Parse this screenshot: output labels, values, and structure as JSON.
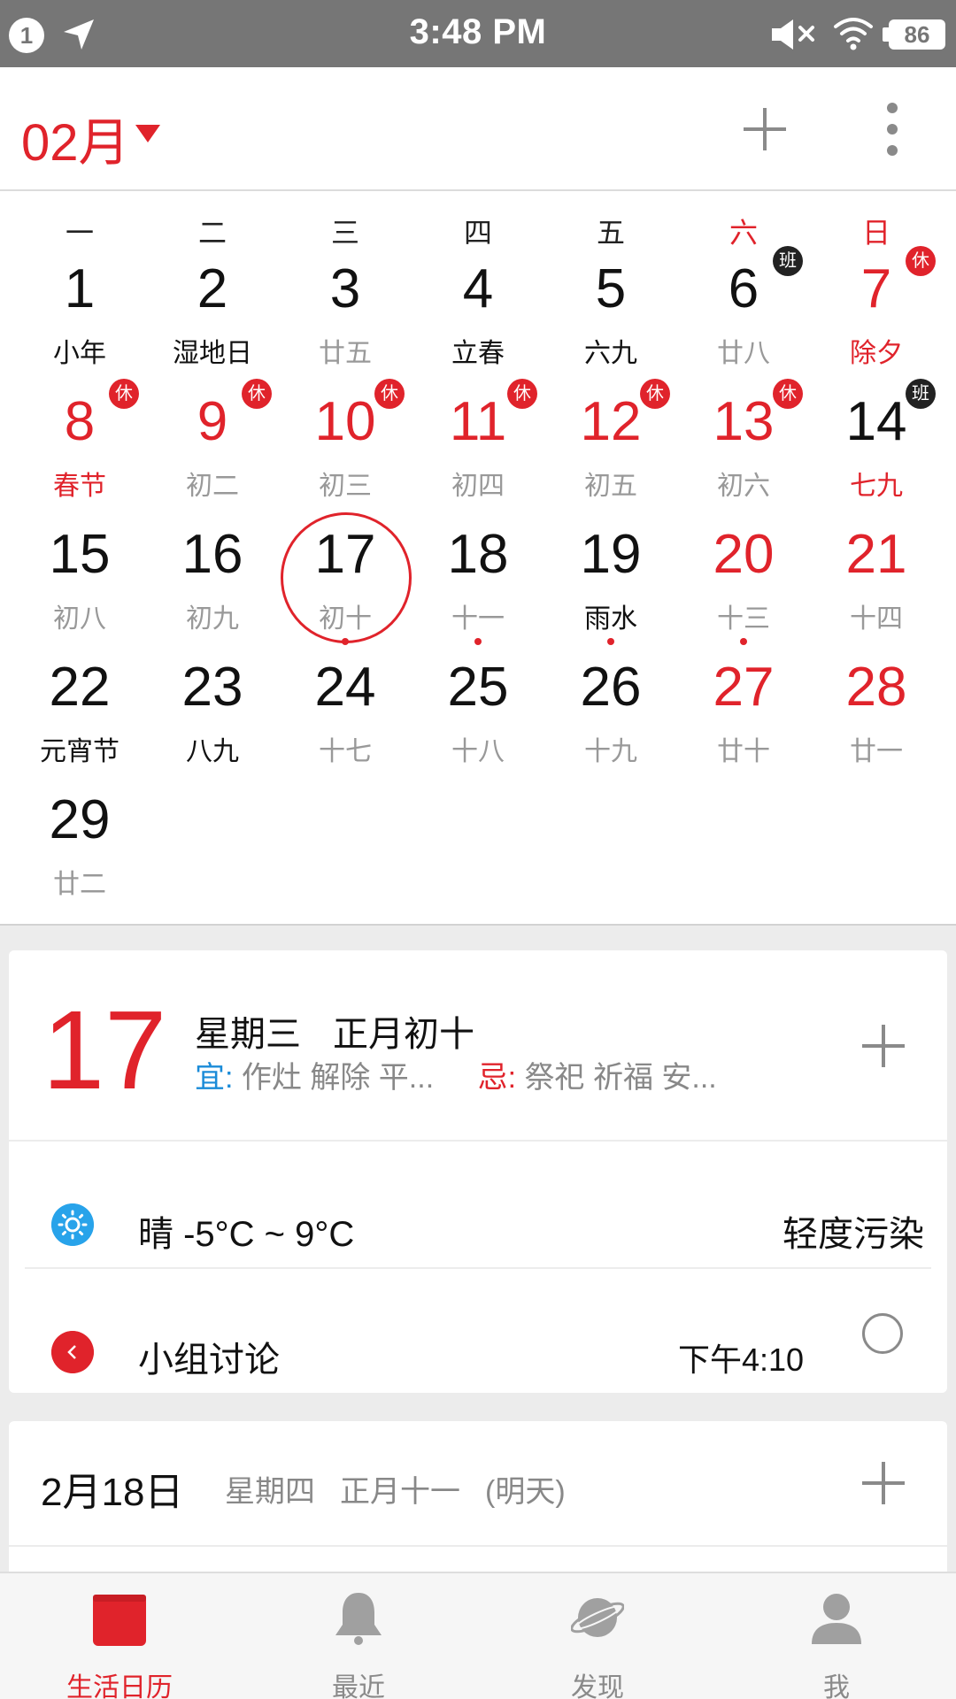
{
  "status_bar": {
    "notification_count": "1",
    "time": "3:48 PM",
    "battery": "86"
  },
  "header": {
    "month": "02月"
  },
  "calendar": {
    "weekdays": [
      "一",
      "二",
      "三",
      "四",
      "五",
      "六",
      "日"
    ],
    "days": [
      {
        "num": "1",
        "sub": "小年"
      },
      {
        "num": "2",
        "sub": "湿地日"
      },
      {
        "num": "3",
        "sub": "廿五"
      },
      {
        "num": "4",
        "sub": "立春"
      },
      {
        "num": "5",
        "sub": "六九"
      },
      {
        "num": "6",
        "sub": "廿八",
        "badge": "班"
      },
      {
        "num": "7",
        "sub": "除夕",
        "badge": "休"
      },
      {
        "num": "8",
        "sub": "春节",
        "badge": "休"
      },
      {
        "num": "9",
        "sub": "初二",
        "badge": "休"
      },
      {
        "num": "10",
        "sub": "初三",
        "badge": "休"
      },
      {
        "num": "11",
        "sub": "初四",
        "badge": "休"
      },
      {
        "num": "12",
        "sub": "初五",
        "badge": "休"
      },
      {
        "num": "13",
        "sub": "初六",
        "badge": "休"
      },
      {
        "num": "14",
        "sub": "七九",
        "badge": "班"
      },
      {
        "num": "15",
        "sub": "初八"
      },
      {
        "num": "16",
        "sub": "初九"
      },
      {
        "num": "17",
        "sub": "初十"
      },
      {
        "num": "18",
        "sub": "十一"
      },
      {
        "num": "19",
        "sub": "雨水"
      },
      {
        "num": "20",
        "sub": "十三"
      },
      {
        "num": "21",
        "sub": "十四"
      },
      {
        "num": "22",
        "sub": "元宵节"
      },
      {
        "num": "23",
        "sub": "八九"
      },
      {
        "num": "24",
        "sub": "十七"
      },
      {
        "num": "25",
        "sub": "十八"
      },
      {
        "num": "26",
        "sub": "十九"
      },
      {
        "num": "27",
        "sub": "廿十"
      },
      {
        "num": "28",
        "sub": "廿一"
      },
      {
        "num": "29",
        "sub": "廿二"
      }
    ]
  },
  "detail": {
    "day": "17",
    "weekday": "星期三",
    "lunar": "正月初十",
    "yi_label": "宜:",
    "yi_text": "作灶 解除 平...",
    "ji_label": "忌:",
    "ji_text": "祭祀 祈福 安...",
    "weather": "晴  -5°C ~ 9°C",
    "air_quality": "轻度污染",
    "event_title": "小组讨论",
    "event_time": "下午4:10"
  },
  "next_day": {
    "date": "2月18日",
    "weekday": "星期四",
    "lunar": "正月十一",
    "relative": "(明天)"
  },
  "tabs": [
    {
      "label": "生活日历"
    },
    {
      "label": "最近"
    },
    {
      "label": "发现"
    },
    {
      "label": "我"
    }
  ],
  "colors": {
    "accent": "#e0232b",
    "yi": "#1a8bd8",
    "weather_icon": "#28a3ea"
  }
}
